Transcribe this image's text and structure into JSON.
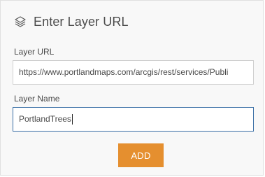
{
  "dialog": {
    "title": "Enter Layer URL",
    "icon": "layers-icon"
  },
  "layer_url": {
    "label": "Layer URL",
    "value": "https://www.portlandmaps.com/arcgis/rest/services/Publi"
  },
  "layer_name": {
    "label": "Layer Name",
    "value": "PortlandTrees"
  },
  "add_button": {
    "label": "ADD",
    "color": "#e58f2f"
  },
  "colors": {
    "accent": "#e58f2f",
    "focus_border": "#3a6fa6",
    "panel_bg": "#f8f8f8"
  }
}
